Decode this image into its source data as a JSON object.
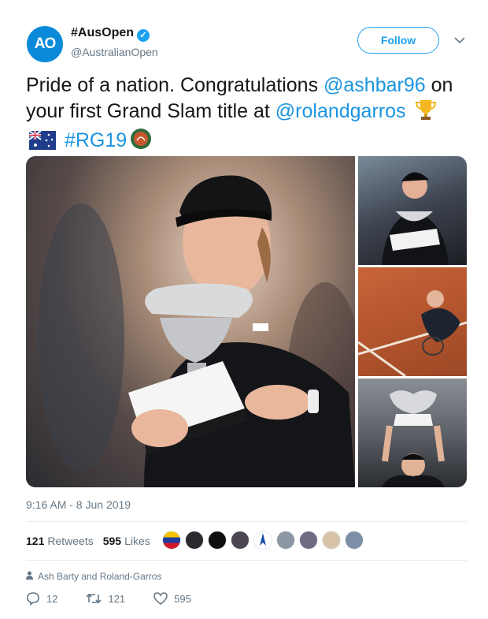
{
  "account": {
    "avatar_text": "AO",
    "display_name": "#AusOpen",
    "verified_glyph": "✓",
    "handle": "@AustralianOpen",
    "follow_label": "Follow",
    "caret_icon": "chevron-down-icon"
  },
  "tweet": {
    "text_part1": "Pride of a nation. Congratulations ",
    "mention1": "@ashbar96",
    "text_part2": " on your first Grand Slam title at ",
    "mention2": "@rolandgarros",
    "hashtag": "#RG19",
    "emojis": [
      "trophy-emoji",
      "australia-flag-emoji",
      "roland-garros-logo"
    ]
  },
  "timestamp": "9:16 AM - 8 Jun 2019",
  "stats": {
    "retweets_count": "121",
    "retweets_label": "Retweets",
    "likes_count": "595",
    "likes_label": "Likes"
  },
  "context": {
    "icon": "person-icon",
    "text": "Ash Barty and Roland-Garros"
  },
  "actions": {
    "reply_count": "12",
    "retweet_count": "121",
    "like_count": "595"
  },
  "colors": {
    "brand_blue": "#1da1f2",
    "link_blue": "#1b95e0",
    "ao_blue": "#0a8ad8",
    "muted": "#657786"
  }
}
